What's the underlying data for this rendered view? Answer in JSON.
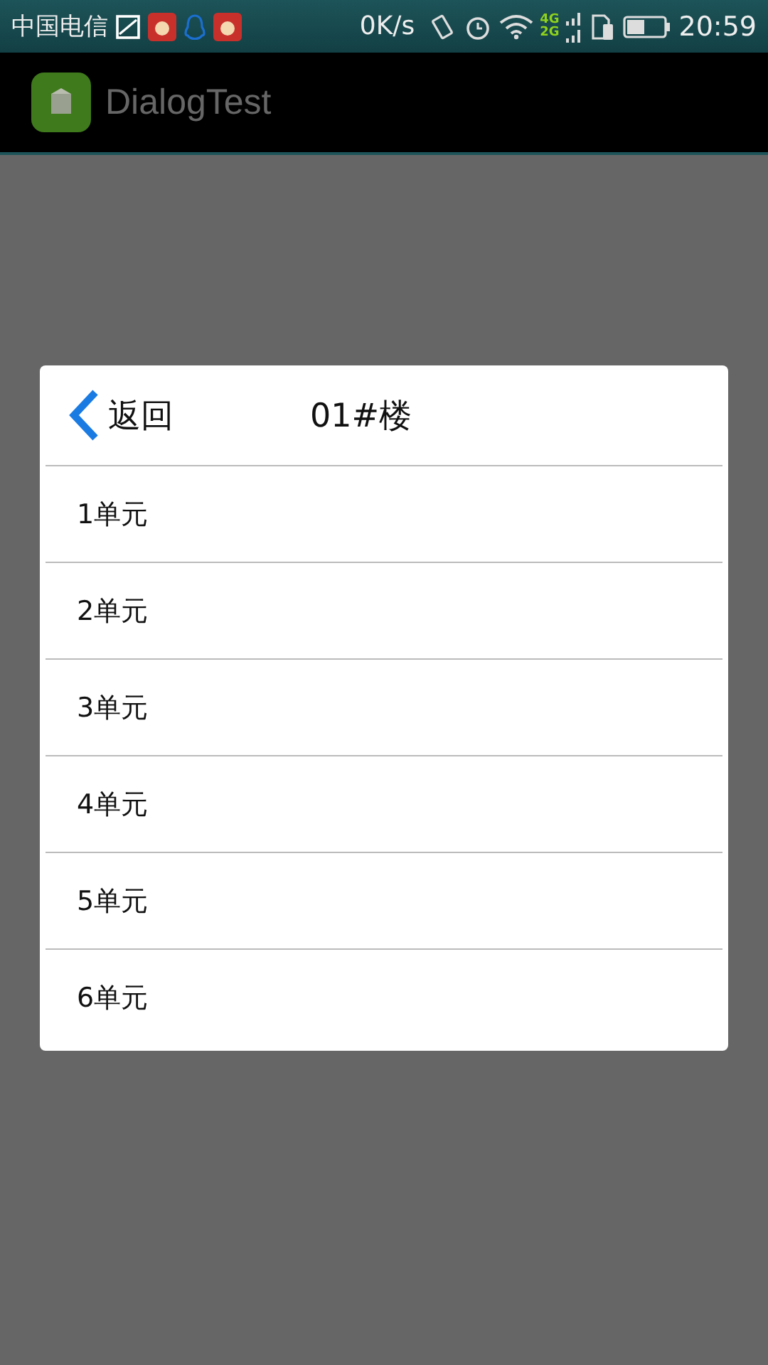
{
  "status_bar": {
    "carrier": "中国电信",
    "speed": "0K/s",
    "network_top": "4G",
    "network_bottom": "2G",
    "time": "20:59"
  },
  "action_bar": {
    "title": "DialogTest"
  },
  "dialog": {
    "back_label": "返回",
    "title": "01#楼",
    "items": [
      {
        "label": "1单元"
      },
      {
        "label": "2单元"
      },
      {
        "label": "3单元"
      },
      {
        "label": "4单元"
      },
      {
        "label": "5单元"
      },
      {
        "label": "6单元"
      }
    ]
  }
}
